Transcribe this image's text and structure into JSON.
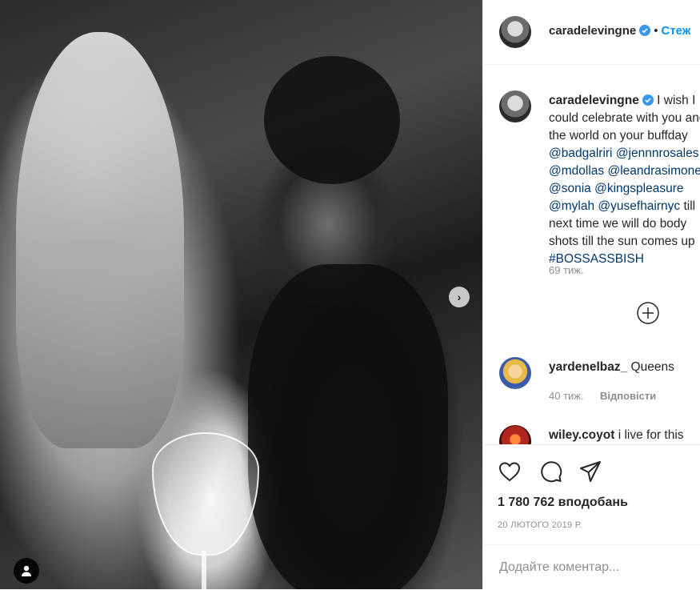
{
  "post": {
    "username": "caradelevingne",
    "follow_label": "Стеж",
    "separator": "•"
  },
  "caption": {
    "username": "caradelevingne",
    "text_1": " I wish I could celebrate with you and the world on your buffday ",
    "mentions_1": [
      "@badgalriri",
      "@jennnrosales",
      "@mdollas",
      "@leandrasimone_",
      "@sonia",
      "@kingspleasure",
      "@mylah",
      "@yusefhairnyc"
    ],
    "text_2": " till next time we will do body shots till the sun comes up ",
    "hashtag": "#BOSSASSBISH",
    "time": "69 тиж."
  },
  "comments": [
    {
      "username": "yardenelbaz_",
      "text": " Queens",
      "time": "40 тиж.",
      "reply_label": "Відповісти"
    },
    {
      "username": "wiley.coyot",
      "text": " i live for this"
    }
  ],
  "stats": {
    "likes": "1 780 762 вподобань",
    "date": "20 ЛЮТОГО 2019 Р."
  },
  "comment_box": {
    "placeholder": "Додайте коментар..."
  },
  "colors": {
    "accent": "#0095f6",
    "mention": "#00376b",
    "muted": "#8e8e8e"
  },
  "icons": [
    "verified-icon",
    "plus-circle-icon",
    "heart-icon",
    "comment-icon",
    "share-icon",
    "chevron-right-icon",
    "user-tag-icon"
  ]
}
